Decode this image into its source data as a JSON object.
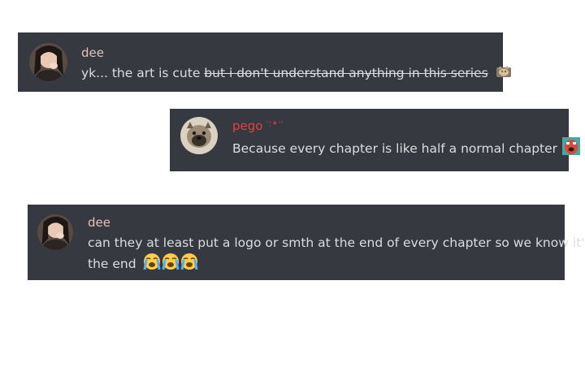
{
  "colors": {
    "background": "#ffffff",
    "message_bg": "#36393f",
    "text": "#dcddde",
    "name_dee": "#e3c2b8",
    "name_pego": "#e84046"
  },
  "messages": [
    {
      "author": "dee",
      "text_plain": "yk... the art is cute ",
      "text_struck": "but i don't understand anything in this series",
      "emoji_icon": "cat-emoji"
    },
    {
      "author": "pego",
      "author_deco": "ⁱ⁺̦∗⁺ⁱ",
      "text": "Because every chapter is like half a normal chapter",
      "emoji_icon": "crying-face-emoji"
    },
    {
      "author": "dee",
      "text_line1": "can they at least put a logo or smth at the end of every chapter so we know it's",
      "text_line2": "the end",
      "emoji_icon": "loudly-crying-face-emoji"
    }
  ]
}
